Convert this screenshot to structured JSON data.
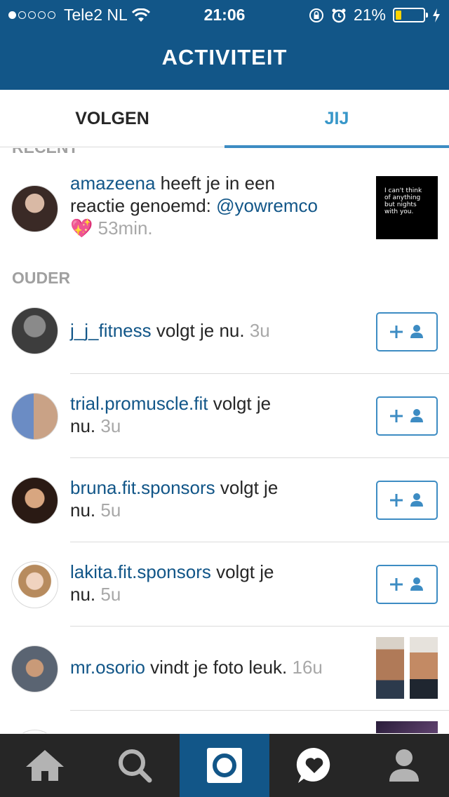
{
  "status_bar": {
    "carrier": "Tele2 NL",
    "time": "21:06",
    "battery": "21%",
    "battery_level": 0.21
  },
  "header": {
    "title": "ACTIVITEIT"
  },
  "tabs": [
    {
      "label": "VOLGEN",
      "active": false
    },
    {
      "label": "JIJ",
      "active": true
    }
  ],
  "sections": {
    "recent": "RECENT",
    "older": "OUDER"
  },
  "recent_items": [
    {
      "username": "amazeena",
      "text_before": " heeft je in een",
      "text_line2": "reactie genoemd: ",
      "mention": "@yowremco",
      "emoji": "💖",
      "time": "53min.",
      "thumb_text": "I can't think of anything but nights with you."
    }
  ],
  "older_items": [
    {
      "username": "j_j_fitness",
      "text": " volgt je nu. ",
      "text2": "",
      "time": "3u",
      "action": "follow"
    },
    {
      "username": "trial.promuscle.fit",
      "text": " volgt je",
      "text2": "nu. ",
      "time": "3u",
      "action": "follow"
    },
    {
      "username": "bruna.fit.sponsors",
      "text": " volgt je",
      "text2": "nu. ",
      "time": "5u",
      "action": "follow"
    },
    {
      "username": "lakita.fit.sponsors",
      "text": " volgt je",
      "text2": "nu. ",
      "time": "5u",
      "action": "follow"
    },
    {
      "username": "mr.osorio",
      "text": " vindt je foto leuk. ",
      "text2": "",
      "time": "16u",
      "action": "photos"
    }
  ],
  "colors": {
    "brand_blue": "#125688",
    "accent_blue": "#3d8cc3",
    "nav_bg": "#262626"
  },
  "nav": [
    {
      "icon": "home-icon"
    },
    {
      "icon": "search-icon"
    },
    {
      "icon": "camera-icon"
    },
    {
      "icon": "activity-heart-icon"
    },
    {
      "icon": "profile-icon"
    }
  ]
}
